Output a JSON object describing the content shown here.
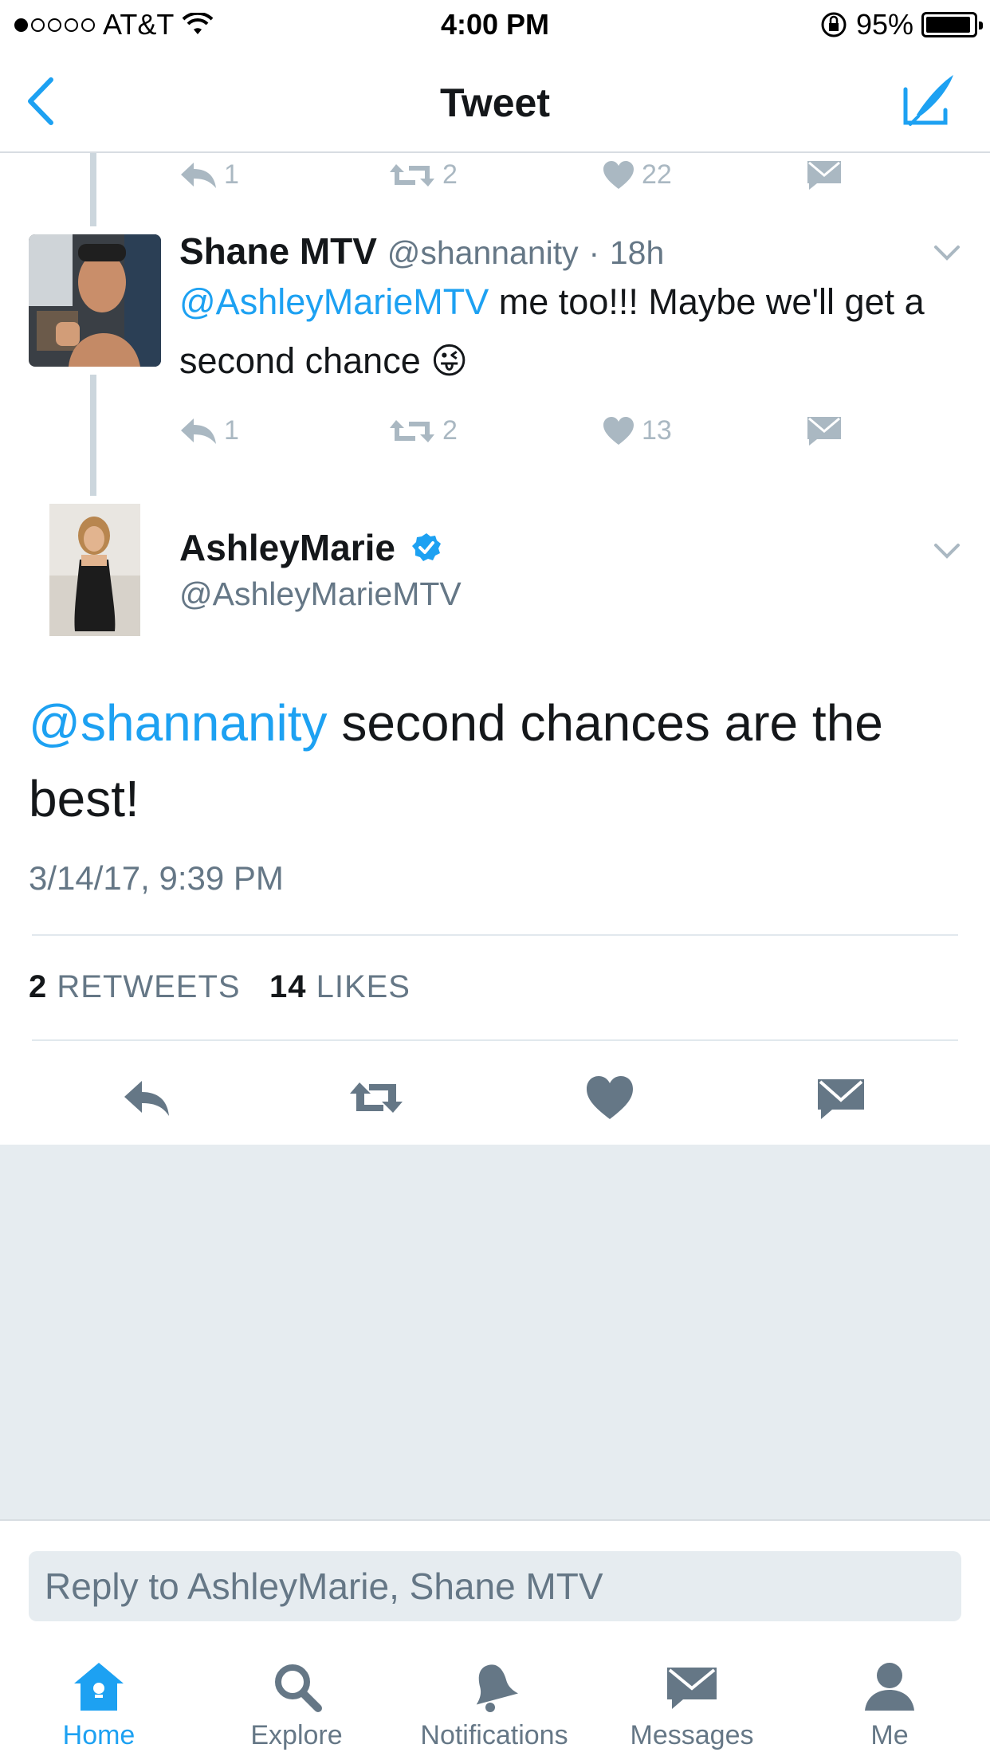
{
  "status_bar": {
    "carrier": "AT&T",
    "signal_bars_filled": 1,
    "signal_bars_total": 5,
    "time": "4:00 PM",
    "battery_percent": "95%",
    "battery_level": 0.95
  },
  "nav": {
    "title": "Tweet",
    "back_icon": "chevron-left-icon",
    "compose_icon": "compose-icon"
  },
  "previous_tweet_actions": {
    "replies": "1",
    "retweets": "2",
    "likes": "22"
  },
  "reply_tweet": {
    "name": "Shane MTV",
    "handle": "@shannanity",
    "separator": "·",
    "time": "18h",
    "mention": "@AshleyMarieMTV",
    "text": "me too!!! Maybe we'll get a second chance",
    "emoji": "😜",
    "actions": {
      "replies": "1",
      "retweets": "2",
      "likes": "13"
    }
  },
  "main_tweet": {
    "name": "AshleyMarie",
    "handle": "@AshleyMarieMTV",
    "verified": true,
    "mention": "@shannanity",
    "text": "second chances are the best!",
    "timestamp": "3/14/17, 9:39 PM",
    "retweet_count": "2",
    "retweet_label": "RETWEETS",
    "like_count": "14",
    "like_label": "LIKES"
  },
  "reply_box": {
    "placeholder": "Reply to AshleyMarie, Shane MTV"
  },
  "tabs": [
    {
      "label": "Home",
      "icon": "home-icon",
      "active": true
    },
    {
      "label": "Explore",
      "icon": "search-icon",
      "active": false
    },
    {
      "label": "Notifications",
      "icon": "bell-icon",
      "active": false
    },
    {
      "label": "Messages",
      "icon": "envelope-icon",
      "active": false
    },
    {
      "label": "Me",
      "icon": "person-icon",
      "active": false
    }
  ],
  "colors": {
    "accent": "#1da1f2",
    "text_primary": "#14171a",
    "text_secondary": "#657786",
    "icon_gray": "#aab8c2",
    "background_gray": "#e6ecf0"
  }
}
